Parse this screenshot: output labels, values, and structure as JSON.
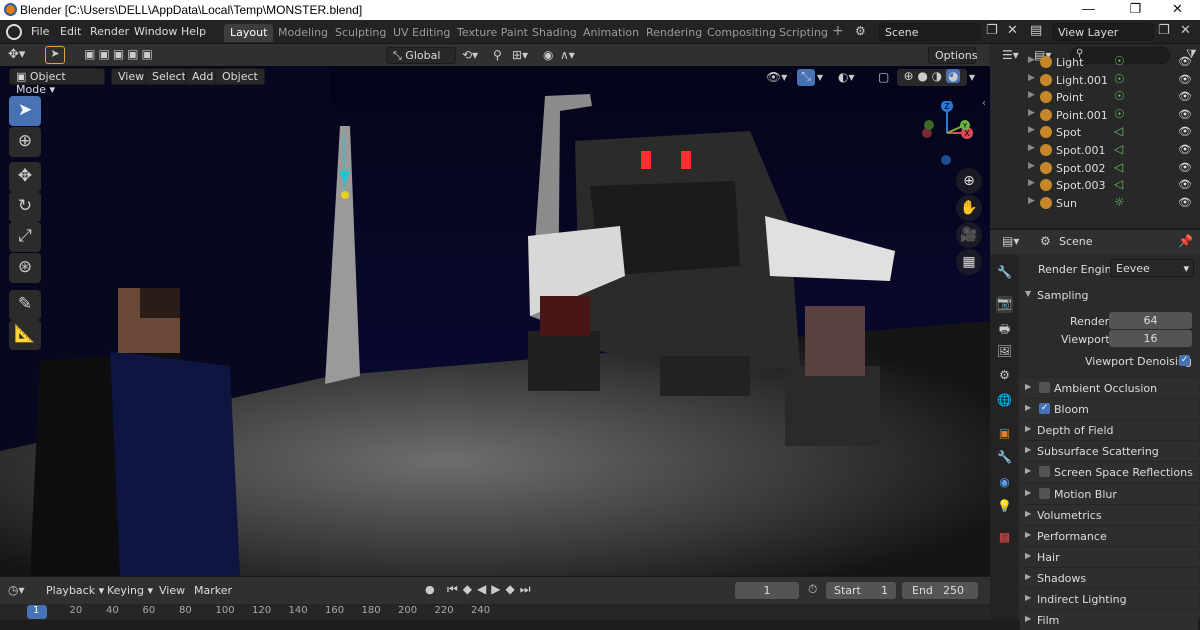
{
  "window": {
    "title": "Blender [C:\\Users\\DELL\\AppData\\Local\\Temp\\MONSTER.blend]",
    "minimize": "—",
    "maximize": "❐",
    "close": "✕"
  },
  "menu": [
    "File",
    "Edit",
    "Render",
    "Window",
    "Help"
  ],
  "workspaces": [
    "Layout",
    "Modeling",
    "Sculpting",
    "UV Editing",
    "Texture Paint",
    "Shading",
    "Animation",
    "Rendering",
    "Compositing",
    "Scripting"
  ],
  "add_workspace": "+",
  "scene_name": "Scene",
  "view_layer": "View Layer",
  "vp_header": {
    "orientation": "Global",
    "options": "Options"
  },
  "vp_header2": {
    "mode": "Object Mode",
    "view": "View",
    "select": "Select",
    "add": "Add",
    "object": "Object"
  },
  "outliner": {
    "search_placeholder": "",
    "items": [
      {
        "name": "Light"
      },
      {
        "name": "Light.001"
      },
      {
        "name": "Point"
      },
      {
        "name": "Point.001"
      },
      {
        "name": "Spot"
      },
      {
        "name": "Spot.001"
      },
      {
        "name": "Spot.002"
      },
      {
        "name": "Spot.003"
      },
      {
        "name": "Sun"
      }
    ]
  },
  "props": {
    "context": "Scene",
    "render_engine_label": "Render Engine",
    "render_engine": "Eevee",
    "sampling": "Sampling",
    "render_label": "Render",
    "render_value": "64",
    "viewport_label": "Viewport",
    "viewport_value": "16",
    "denoise_label": "Viewport Denoising",
    "sections": [
      {
        "label": "Ambient Occlusion",
        "checkbox": true,
        "checked": false
      },
      {
        "label": "Bloom",
        "checkbox": true,
        "checked": true
      },
      {
        "label": "Depth of Field",
        "checkbox": false
      },
      {
        "label": "Subsurface Scattering",
        "checkbox": false
      },
      {
        "label": "Screen Space Reflections",
        "checkbox": true,
        "checked": false
      },
      {
        "label": "Motion Blur",
        "checkbox": true,
        "checked": false
      },
      {
        "label": "Volumetrics",
        "checkbox": false
      },
      {
        "label": "Performance",
        "checkbox": false
      },
      {
        "label": "Hair",
        "checkbox": false
      },
      {
        "label": "Shadows",
        "checkbox": false
      },
      {
        "label": "Indirect Lighting",
        "checkbox": false
      },
      {
        "label": "Film",
        "checkbox": false
      }
    ]
  },
  "timeline": {
    "playback": "Playback",
    "keying": "Keying",
    "view": "View",
    "marker": "Marker",
    "current_frame": "1",
    "start_label": "Start",
    "start": "1",
    "end_label": "End",
    "end": "250",
    "ruler": [
      "1",
      "20",
      "40",
      "60",
      "80",
      "100",
      "120",
      "140",
      "160",
      "180",
      "200",
      "220",
      "240"
    ]
  },
  "gizmo": {
    "z": "Z",
    "x": "X",
    "y": "Y"
  },
  "colors": {
    "accent": "#4772b3",
    "header": "#303030",
    "panel": "#2b2b2b",
    "light_icon": "#c6872b"
  }
}
